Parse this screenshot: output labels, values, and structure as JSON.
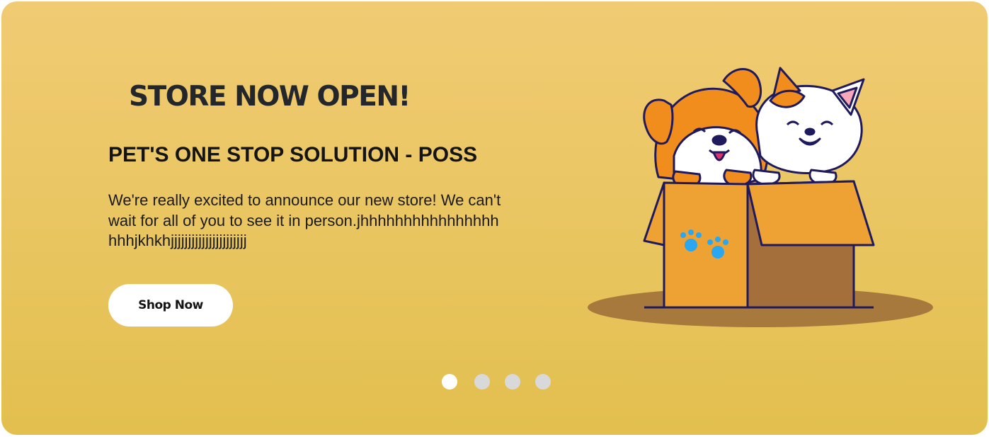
{
  "banner": {
    "headline": "STORE NOW OPEN!",
    "subheadline": "PET'S ONE STOP SOLUTION - POSS",
    "description": "We're really excited to announce our new store! We can't wait for all of you to see it in person.jhhhhhhhhhhhhhhhhhhhjkhkhjjjjjjjjjjjjjjjjjjjjjj",
    "cta_label": "Shop Now",
    "illustration": "puppy-and-kitten-in-box-illustration"
  },
  "carousel": {
    "slide_count": 4,
    "active_index": 0
  },
  "colors": {
    "banner_top": "#f1cb73",
    "banner_bottom": "#e2bf4e",
    "text_dark": "#23272b",
    "button_bg": "#ffffff",
    "dot_active": "#ffffff",
    "dot_inactive": "#d9d9d9"
  }
}
